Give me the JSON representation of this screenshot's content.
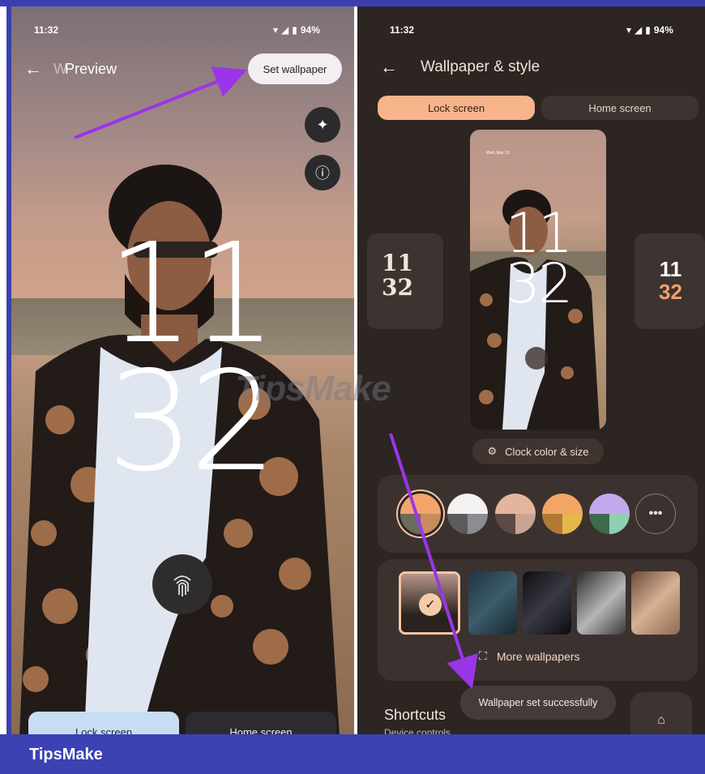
{
  "left_screen": {
    "time": "11:32",
    "battery": "94%",
    "title": "Preview",
    "title_ghost": "W",
    "set_wallpaper_label": "Set wallpaper",
    "clock_hour": "11",
    "clock_minute": "32",
    "tabs": [
      "Lock screen",
      "Home screen"
    ]
  },
  "right_screen": {
    "time": "11:32",
    "battery": "94%",
    "title": "Wallpaper & style",
    "tabs": [
      "Lock screen",
      "Home screen"
    ],
    "preview_clock_hour": "11",
    "preview_clock_minute": "32",
    "preview_date": "Wed, Mar 15",
    "side_clock_hour": "11",
    "side_clock_minute": "32",
    "clock_button_label": "Clock color & size",
    "swatches": [
      {
        "top": "#f5a36c",
        "bl": "#6a6c5c",
        "br": "#c78b5d"
      },
      {
        "top": "#f4f1f1",
        "bl": "#5a5b5d",
        "br": "#8c8d90"
      },
      {
        "top": "#e3b59c",
        "bl": "#5c4b44",
        "br": "#c9a393"
      },
      {
        "top": "#f3a664",
        "bl": "#b07a36",
        "br": "#e3b84a"
      },
      {
        "top": "#c4a9ef",
        "bl": "#3e6b4b",
        "br": "#8fd0b3"
      }
    ],
    "more_colors_icon": "more-horiz-icon",
    "more_wallpapers_label": "More wallpapers",
    "toast": "Wallpaper set successfully",
    "shortcuts_title": "Shortcuts",
    "shortcuts_subtitle": "Device controls"
  },
  "footer": {
    "brand": "TipsMake"
  },
  "watermark": "TipsMake"
}
